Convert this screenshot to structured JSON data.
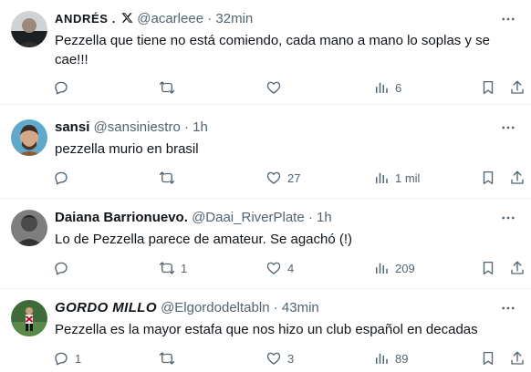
{
  "colors": {
    "text": "#0f1419",
    "muted": "#536471",
    "divider": "#eff3f4"
  },
  "icons": {
    "reply": "speech-bubble-icon",
    "retweet": "retweet-icon",
    "like": "heart-icon",
    "views": "bar-chart-icon",
    "bookmark": "bookmark-icon",
    "share": "share-icon",
    "more": "ellipsis-icon",
    "verified": "x-logo-icon"
  },
  "tweets": [
    {
      "name": "ANDRÉS .",
      "handle": "@acarleee",
      "sep": "·",
      "time": "32min",
      "text": "Pezzella que tiene no está comiendo, cada mano a mano lo soplas y se cae!!!",
      "replies": "",
      "retweets": "",
      "likes": "",
      "views": "6"
    },
    {
      "name": "sansi",
      "handle": "@sansiniestro",
      "sep": "·",
      "time": "1h",
      "text": "pezzella murio en brasil",
      "replies": "",
      "retweets": "",
      "likes": "27",
      "views": "1 mil"
    },
    {
      "name": "Daiana Barrionuevo.",
      "handle": "@Daai_RiverPlate",
      "sep": "·",
      "time": "1h",
      "text": "Lo de Pezzella parece de amateur. Se agachó (!)",
      "replies": "",
      "retweets": "1",
      "likes": "4",
      "views": "209"
    },
    {
      "name": "GORDO MILLO",
      "handle": "@Elgordodeltabln",
      "sep": "·",
      "time": "43min",
      "text": "Pezzella es la mayor estafa que nos hizo un club español en decadas",
      "replies": "1",
      "retweets": "",
      "likes": "3",
      "views": "89"
    }
  ]
}
